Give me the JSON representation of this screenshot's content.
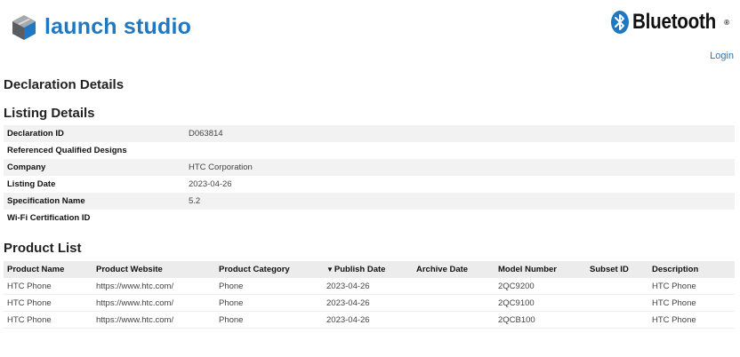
{
  "header": {
    "brand": "launch studio",
    "partner": "Bluetooth",
    "partner_mark": "®",
    "login": "Login"
  },
  "sections": {
    "declaration": "Declaration Details",
    "listing": "Listing Details",
    "products": "Product List"
  },
  "listing": [
    {
      "label": "Declaration ID",
      "value": "D063814"
    },
    {
      "label": "Referenced Qualified Designs",
      "value": ""
    },
    {
      "label": "Company",
      "value": "HTC Corporation"
    },
    {
      "label": "Listing Date",
      "value": "2023-04-26"
    },
    {
      "label": "Specification Name",
      "value": "5.2"
    },
    {
      "label": "Wi-Fi Certification ID",
      "value": ""
    }
  ],
  "product_table": {
    "sort_indicator": "▼",
    "headers": [
      "Product Name",
      "Product Website",
      "Product Category",
      "Publish Date",
      "Archive Date",
      "Model Number",
      "Subset ID",
      "Description"
    ],
    "rows": [
      [
        "HTC Phone",
        "https://www.htc.com/",
        "Phone",
        "2023-04-26",
        "",
        "2QC9200",
        "",
        "HTC Phone"
      ],
      [
        "HTC Phone",
        "https://www.htc.com/",
        "Phone",
        "2023-04-26",
        "",
        "2QC9100",
        "",
        "HTC Phone"
      ],
      [
        "HTC Phone",
        "https://www.htc.com/",
        "Phone",
        "2023-04-26",
        "",
        "2QCB100",
        "",
        "HTC Phone"
      ]
    ]
  },
  "colors": {
    "brand_blue": "#1f78c1",
    "row_stripe": "#f2f2f2",
    "header_bg": "#ececec"
  }
}
